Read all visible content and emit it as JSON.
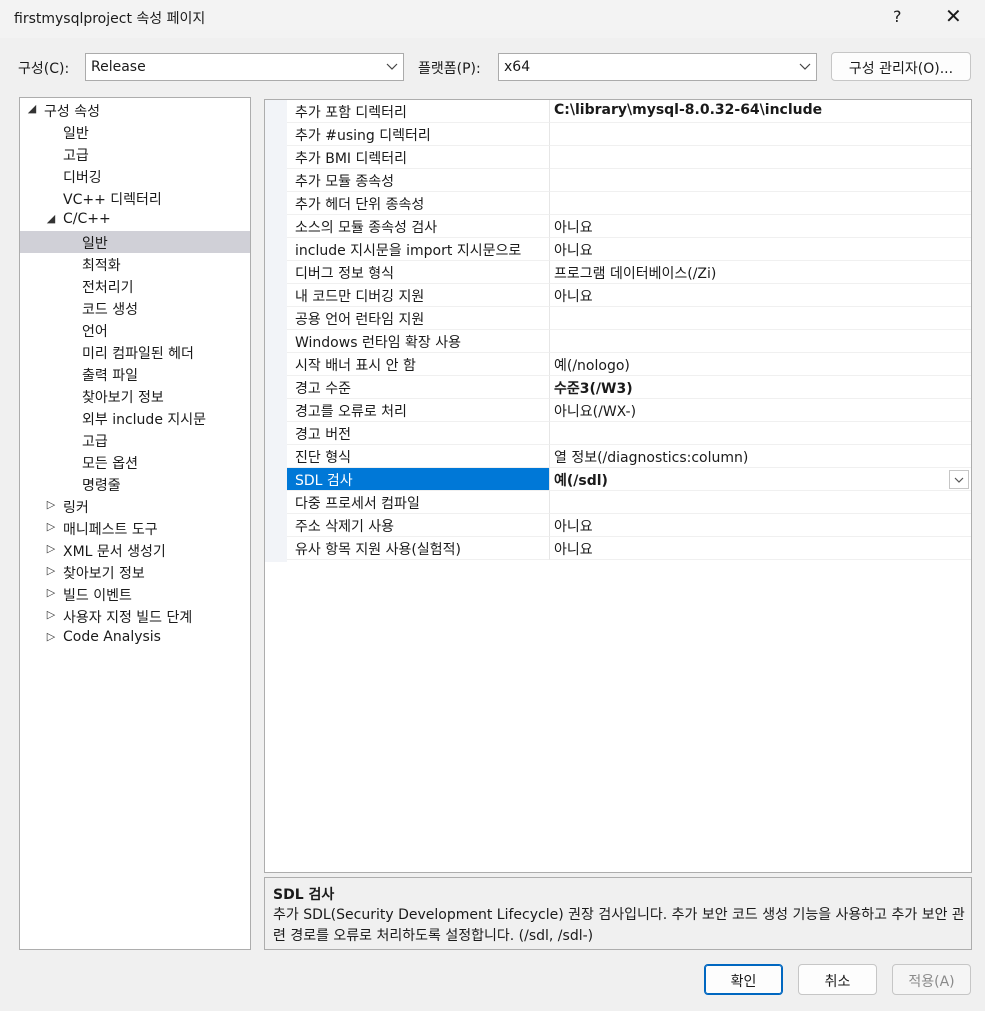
{
  "window": {
    "title": "firstmysqlproject 속성 페이지",
    "help": "?",
    "close": "✕"
  },
  "toolbar": {
    "config_label": "구성(C):",
    "config_value": "Release",
    "platform_label": "플랫폼(P):",
    "platform_value": "x64",
    "config_manager_label": "구성 관리자(O)..."
  },
  "tree": [
    {
      "label": "구성 속성",
      "expander": "◢"
    },
    {
      "label": "일반"
    },
    {
      "label": "고급"
    },
    {
      "label": "디버깅"
    },
    {
      "label": "VC++ 디렉터리"
    },
    {
      "label": "C/C++",
      "expander": "◢"
    },
    {
      "label": "일반"
    },
    {
      "label": "최적화"
    },
    {
      "label": "전처리기"
    },
    {
      "label": "코드 생성"
    },
    {
      "label": "언어"
    },
    {
      "label": "미리 컴파일된 헤더"
    },
    {
      "label": "출력 파일"
    },
    {
      "label": "찾아보기 정보"
    },
    {
      "label": "외부 include 지시문"
    },
    {
      "label": "고급"
    },
    {
      "label": "모든 옵션"
    },
    {
      "label": "명령줄"
    },
    {
      "label": "링커",
      "expander": "▷"
    },
    {
      "label": "매니페스트 도구",
      "expander": "▷"
    },
    {
      "label": "XML 문서 생성기",
      "expander": "▷"
    },
    {
      "label": "찾아보기 정보",
      "expander": "▷"
    },
    {
      "label": "빌드 이벤트",
      "expander": "▷"
    },
    {
      "label": "사용자 지정 빌드 단계",
      "expander": "▷"
    },
    {
      "label": "Code Analysis",
      "expander": "▷"
    }
  ],
  "properties": [
    {
      "name": "추가 포함 디렉터리",
      "value": "C:\\library\\mysql-8.0.32-64\\include"
    },
    {
      "name": "추가 #using 디렉터리",
      "value": ""
    },
    {
      "name": "추가 BMI 디렉터리",
      "value": ""
    },
    {
      "name": "추가 모듈 종속성",
      "value": ""
    },
    {
      "name": "추가 헤더 단위 종속성",
      "value": ""
    },
    {
      "name": "소스의 모듈 종속성 검사",
      "value": "아니요"
    },
    {
      "name": "include 지시문을 import 지시문으로",
      "value": "아니요"
    },
    {
      "name": "디버그 정보 형식",
      "value": "프로그램 데이터베이스(/Zi)"
    },
    {
      "name": "내 코드만 디버깅 지원",
      "value": "아니요"
    },
    {
      "name": "공용 언어 런타임 지원",
      "value": ""
    },
    {
      "name": "Windows 런타임 확장 사용",
      "value": ""
    },
    {
      "name": "시작 배너 표시 안 함",
      "value": "예(/nologo)"
    },
    {
      "name": "경고 수준",
      "value": "수준3(/W3)"
    },
    {
      "name": "경고를 오류로 처리",
      "value": "아니요(/WX-)"
    },
    {
      "name": "경고 버전",
      "value": ""
    },
    {
      "name": "진단 형식",
      "value": "열 정보(/diagnostics:column)"
    },
    {
      "name": "SDL 검사",
      "value": "예(/sdl)"
    },
    {
      "name": "다중 프로세서 컴파일",
      "value": ""
    },
    {
      "name": "주소 삭제기 사용",
      "value": "아니요"
    },
    {
      "name": "유사 항목 지원 사용(실험적)",
      "value": "아니요"
    }
  ],
  "description": {
    "title": "SDL 검사",
    "text": "추가 SDL(Security Development Lifecycle) 권장 검사입니다. 추가 보안 코드 생성 기능을 사용하고 추가 보안 관련 경로를 오류로 처리하도록 설정합니다. (/sdl, /sdl-)"
  },
  "buttons": {
    "ok": "확인",
    "cancel": "취소",
    "apply": "적용(A)"
  },
  "colors": {
    "selection": "#0078d7",
    "tree_selection": "#d0d0d7"
  }
}
